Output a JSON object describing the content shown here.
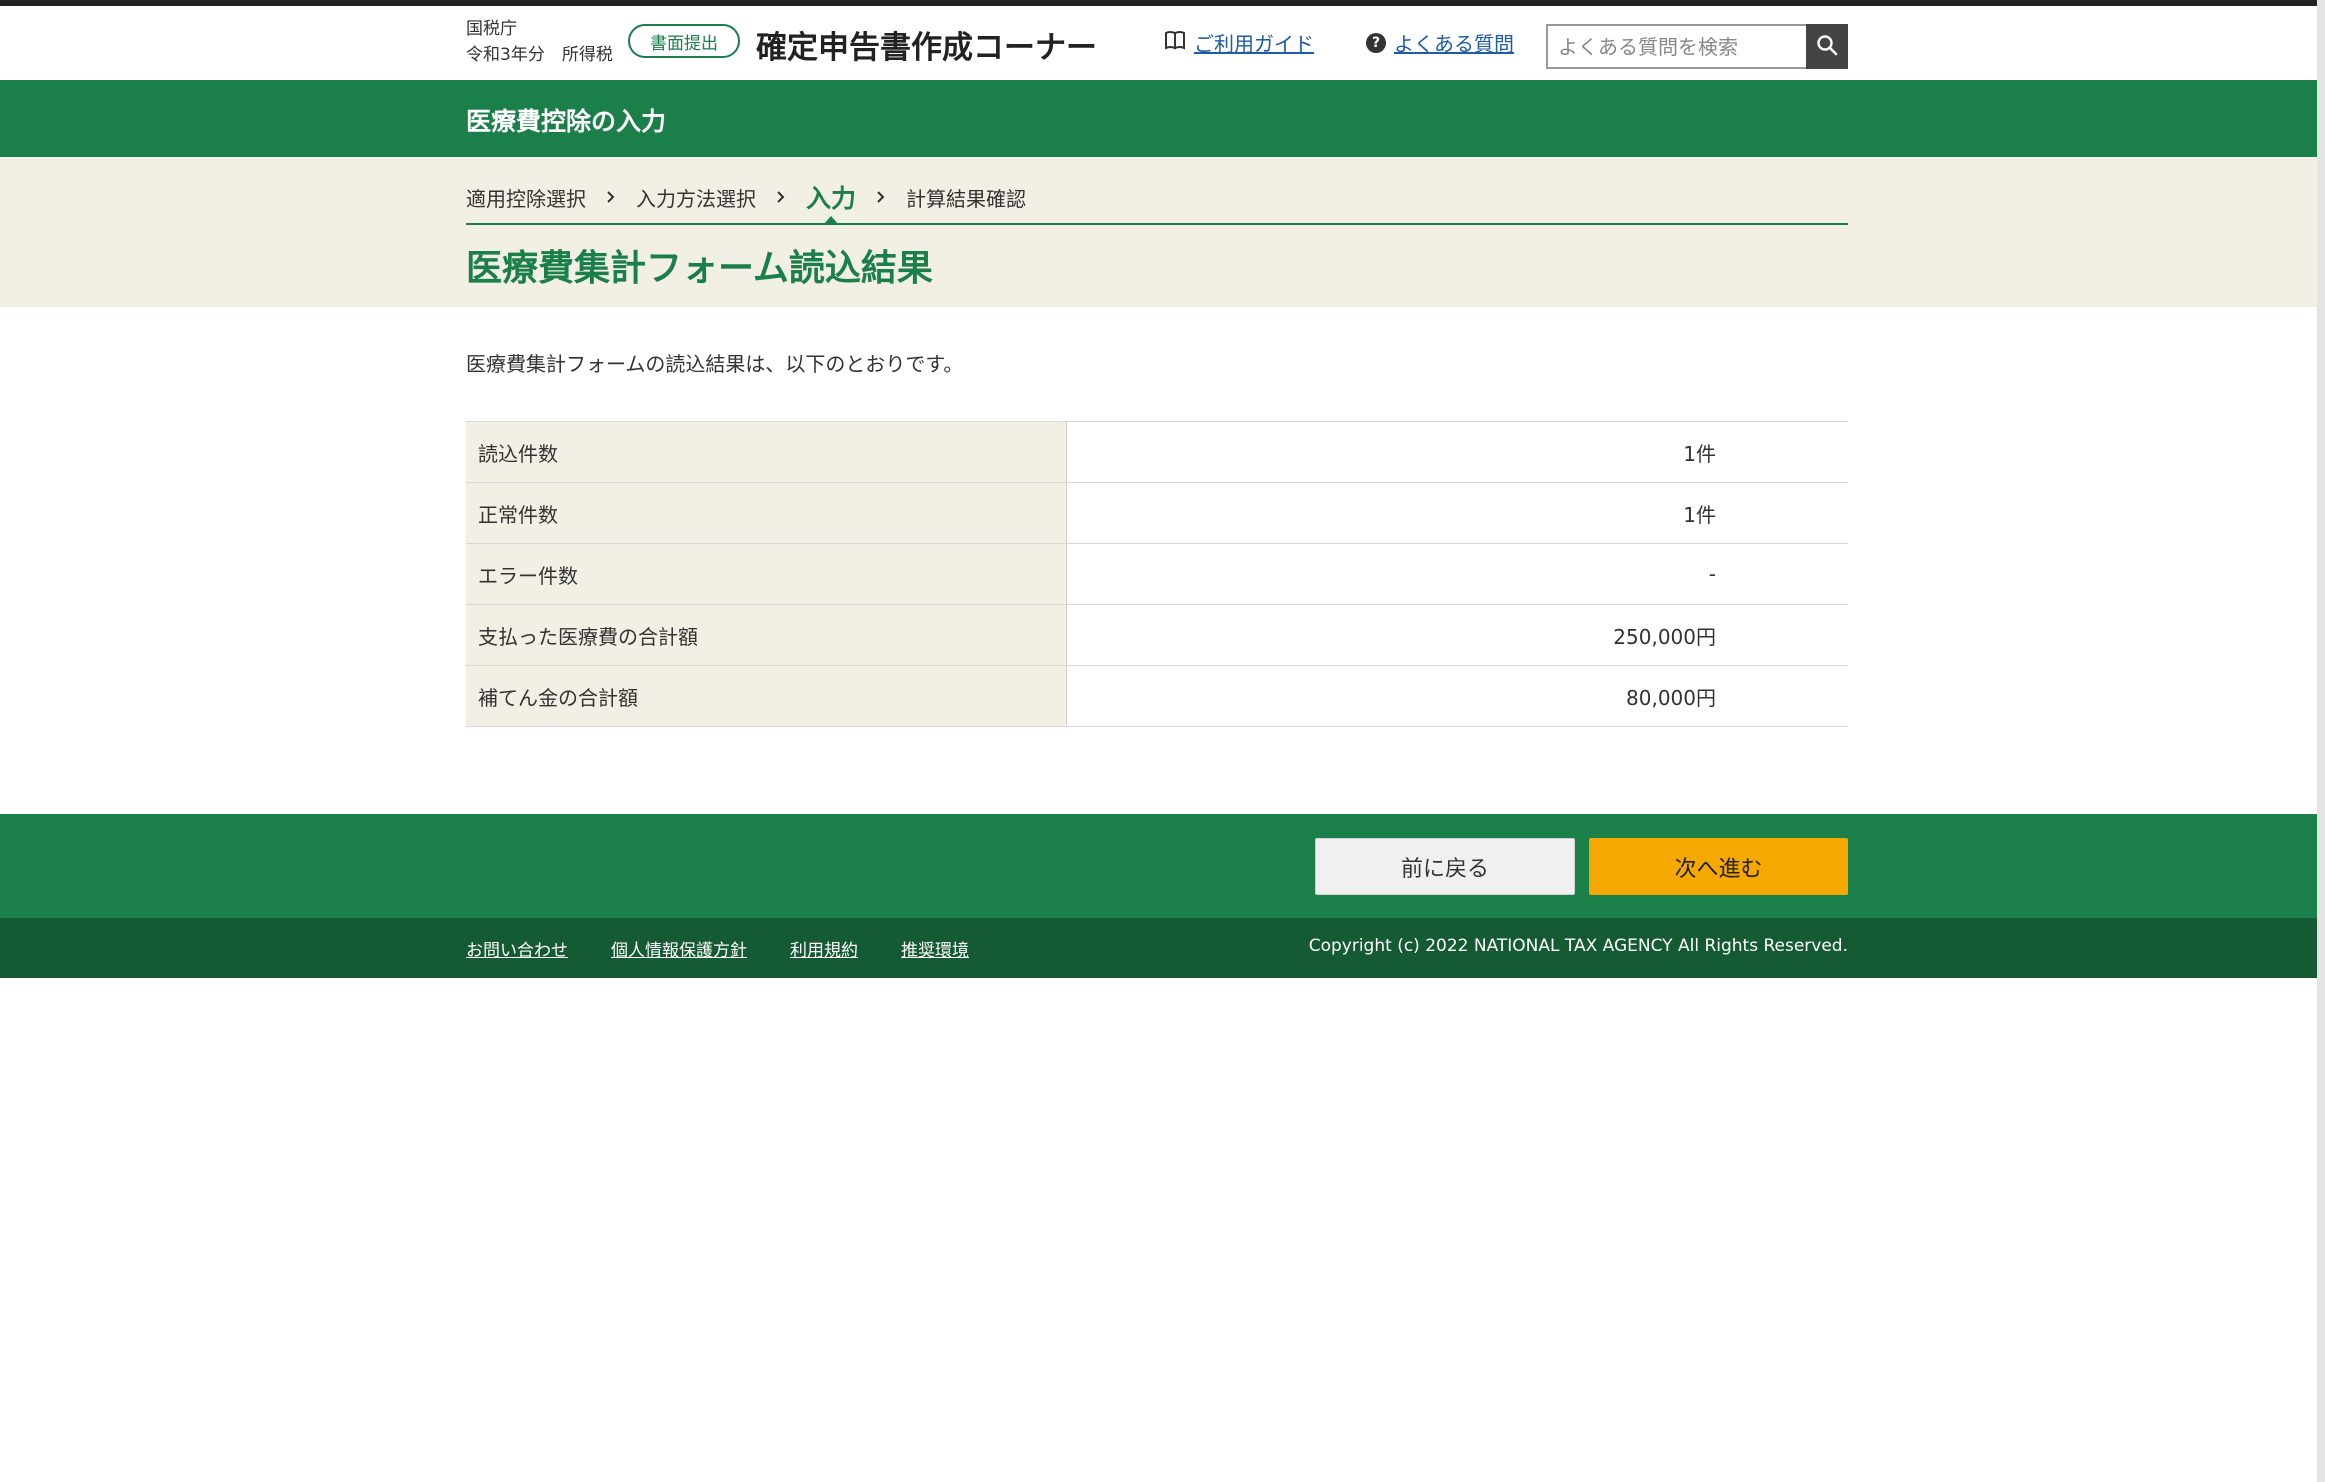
{
  "header": {
    "agency": "国税庁",
    "year_tax": "令和3年分　所得税",
    "submit_badge": "書面提出",
    "site_title": "確定申告書作成コーナー",
    "guide_link": "ご利用ガイド",
    "faq_link": "よくある質問",
    "search_placeholder": "よくある質問を検索",
    "icons": {
      "guide": "book-icon",
      "faq": "question-circle-icon",
      "search": "search-icon"
    }
  },
  "band": {
    "title": "医療費控除の入力"
  },
  "steps": {
    "items": [
      {
        "label": "適用控除選択",
        "active": false
      },
      {
        "label": "入力方法選択",
        "active": false
      },
      {
        "label": "入力",
        "active": true
      },
      {
        "label": "計算結果確認",
        "active": false
      }
    ]
  },
  "page": {
    "title": "医療費集計フォーム読込結果",
    "lead": "医療費集計フォームの読込結果は、以下のとおりです。"
  },
  "results": {
    "rows": [
      {
        "label": "読込件数",
        "value": "1件"
      },
      {
        "label": "正常件数",
        "value": "1件"
      },
      {
        "label": "エラー件数",
        "value": "-"
      },
      {
        "label": "支払った医療費の合計額",
        "value": "250,000円"
      },
      {
        "label": "補てん金の合計額",
        "value": "80,000円"
      }
    ]
  },
  "actions": {
    "back": "前に戻る",
    "next": "次へ進む"
  },
  "footer": {
    "links": [
      "お問い合わせ",
      "個人情報保護方針",
      "利用規約",
      "推奨環境"
    ],
    "copyright": "Copyright (c) 2022 NATIONAL TAX AGENCY All Rights Reserved."
  },
  "colors": {
    "primary_green": "#1a7f48",
    "footer_green": "#145a33",
    "beige": "#f2efe4",
    "next_button": "#f5a800",
    "link_blue": "#1e5ca8"
  }
}
